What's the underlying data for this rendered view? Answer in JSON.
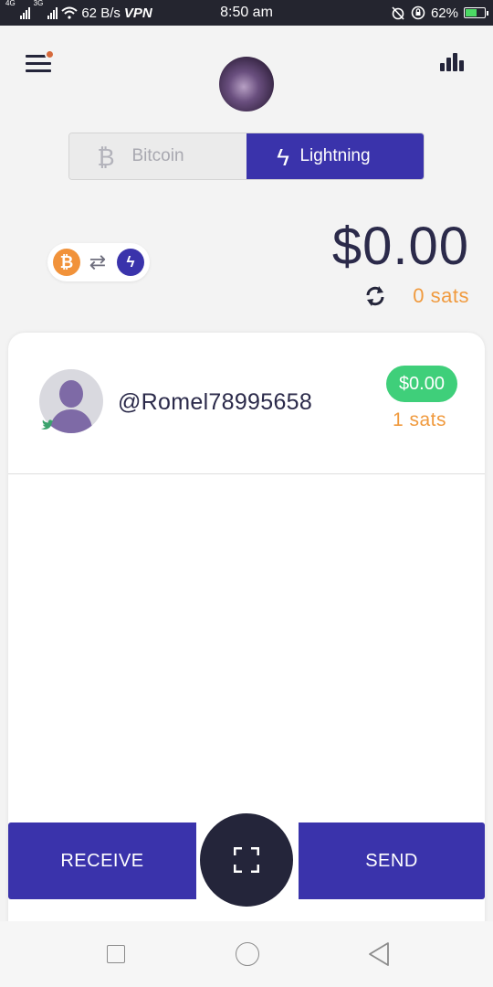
{
  "status_bar": {
    "signal1_tag": "4G",
    "signal2_tag": "3G",
    "speed": "62 B/s",
    "vpn": "VPN",
    "time": "8:50 am",
    "battery": "62%",
    "battery_level": 0.62
  },
  "header": {
    "menu_icon": "hamburger-menu-icon",
    "stats_icon": "bar-chart-icon"
  },
  "toggle": {
    "bitcoin_label": "Bitcoin",
    "lightning_label": "Lightning",
    "bitcoin_glyph": "₿",
    "lightning_glyph": "ϟ",
    "active": "Lightning"
  },
  "balance": {
    "usd": "$0.00",
    "sats": "0 sats",
    "swap_btc_glyph": "₿",
    "swap_arrows_glyph": "⇄",
    "swap_ln_glyph": "ϟ"
  },
  "account": {
    "name": "@Romel78995658",
    "usd": "$0.00",
    "sats": "1 sats"
  },
  "actions": {
    "receive_label": "RECEIVE",
    "send_label": "SEND",
    "scan_icon": "scan-qr-icon"
  },
  "colors": {
    "primary": "#3a33ab",
    "dark": "#24253a",
    "sats_orange": "#f09a3e",
    "green": "#3fcf7a",
    "bitcoin_orange": "#f1923a"
  }
}
